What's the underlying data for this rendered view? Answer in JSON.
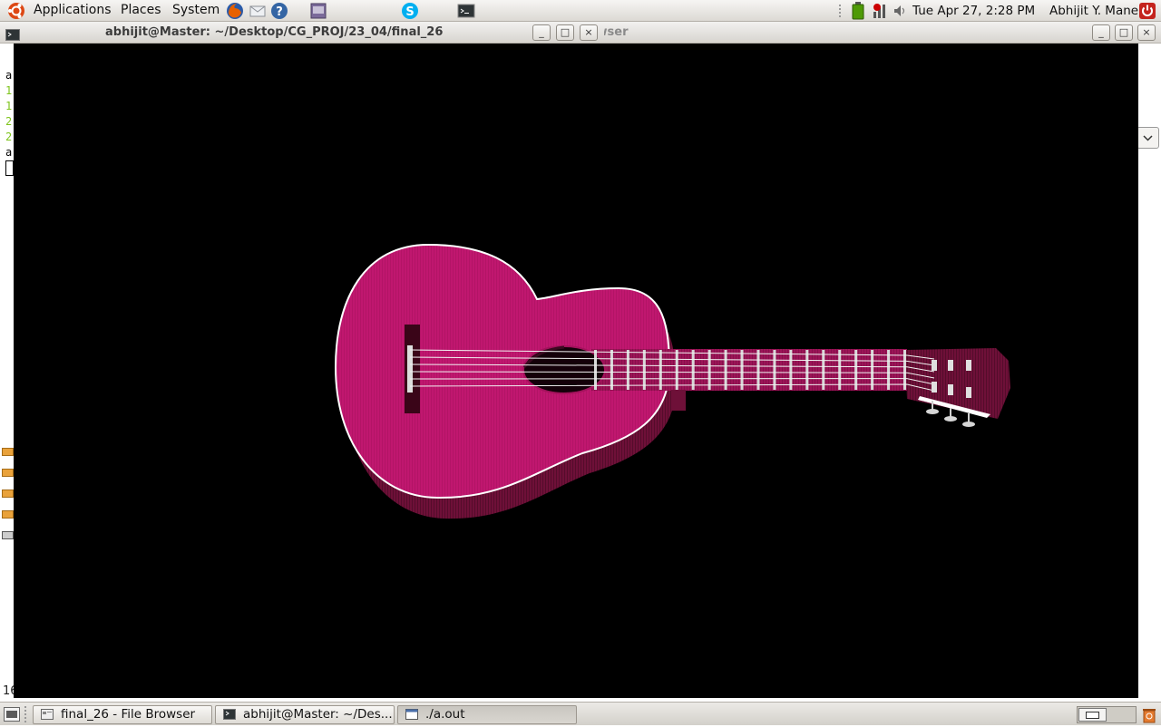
{
  "top_panel": {
    "menus": [
      "Applications",
      "Places",
      "System"
    ],
    "launchers": [
      "firefox-icon",
      "mail-icon",
      "help-icon",
      "image-viewer-icon",
      "skype-icon",
      "terminal-icon"
    ],
    "clock": "Tue Apr 27,  2:28 PM",
    "user": "Abhijit Y. Mane"
  },
  "terminal": {
    "title": "abhijit@Master: ~/Desktop/CG_PROJ/23_04/final_26",
    "line_chars": [
      "a",
      "1",
      "1",
      "2",
      "2",
      "a"
    ],
    "line_colors": [
      "#000000",
      "#7ec41c",
      "#7ec41c",
      "#7ec41c",
      "#7ec41c",
      "#000000"
    ]
  },
  "file_browser": {
    "title": "final_26 - File Browser"
  },
  "status_fragment": "16",
  "taskbar": {
    "items": [
      {
        "label": "final_26 - File Browser",
        "icon": "file-browser-icon"
      },
      {
        "label": "abhijit@Master: ~/Des...",
        "icon": "terminal-icon"
      },
      {
        "label": "./a.out",
        "icon": "window-icon"
      }
    ]
  },
  "gl_scene": {
    "subject": "guitar",
    "body_color": "#c0176f",
    "side_color": "#6e1038",
    "fret_count": 20,
    "string_count": 6
  }
}
